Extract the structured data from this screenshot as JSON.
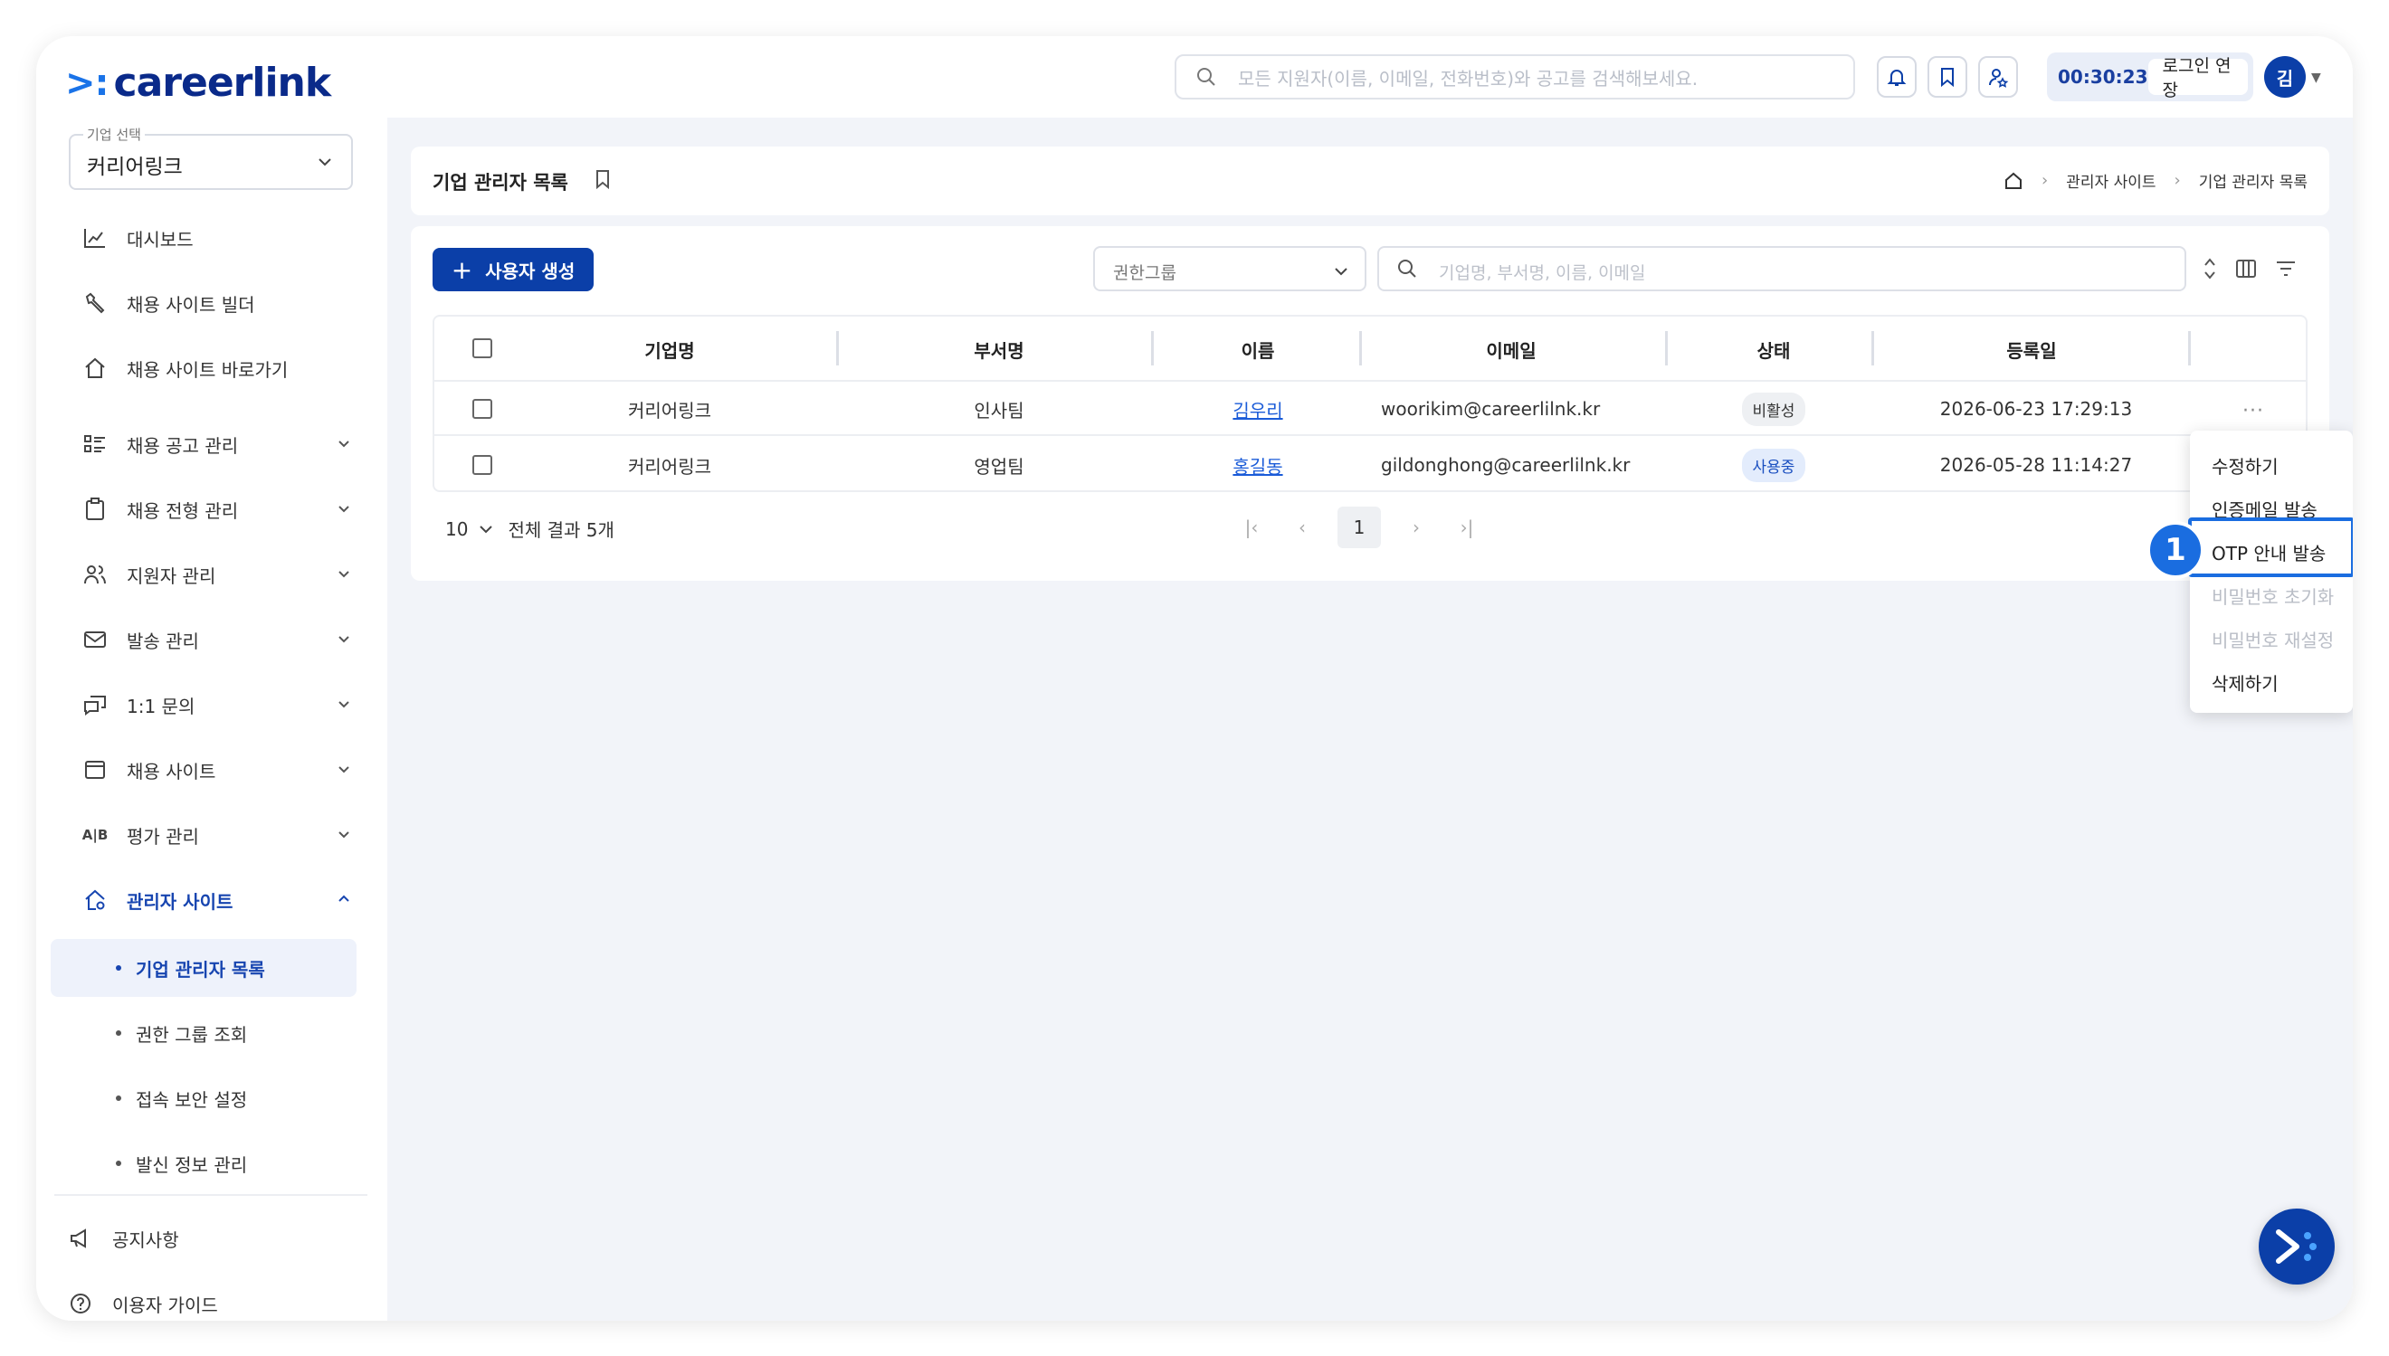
{
  "brand": {
    "logo_text": "careerlink"
  },
  "header": {
    "search_placeholder": "모든 지원자(이름, 이메일, 전화번호)와 공고를 검색해보세요.",
    "session_time": "00:30:23",
    "extend_label": "로그인 연장",
    "avatar_initial": "김"
  },
  "sidebar": {
    "company_label": "기업 선택",
    "company_value": "커리어링크",
    "items": [
      {
        "label": "대시보드"
      },
      {
        "label": "채용 사이트 빌더"
      },
      {
        "label": "채용 사이트 바로가기"
      },
      {
        "label": "채용 공고 관리"
      },
      {
        "label": "채용 전형 관리"
      },
      {
        "label": "지원자 관리"
      },
      {
        "label": "발송 관리"
      },
      {
        "label": "1:1 문의"
      },
      {
        "label": "채용 사이트"
      },
      {
        "label": "평가 관리"
      },
      {
        "label": "관리자 사이트"
      }
    ],
    "sub_items": [
      {
        "label": "기업 관리자 목록"
      },
      {
        "label": "권한 그룹 조회"
      },
      {
        "label": "접속 보안 설정"
      },
      {
        "label": "발신 정보 관리"
      }
    ],
    "footer": [
      {
        "label": "공지사항"
      },
      {
        "label": "이용자 가이드"
      }
    ]
  },
  "page": {
    "title": "기업 관리자 목록",
    "breadcrumb": [
      "관리자 사이트",
      "기업 관리자 목록"
    ]
  },
  "toolbar": {
    "create_label": "사용자 생성",
    "role_select": "권한그룹",
    "search_placeholder": "기업명, 부서명, 이름, 이메일"
  },
  "table": {
    "columns": [
      "기업명",
      "부서명",
      "이름",
      "이메일",
      "상태",
      "등록일"
    ],
    "rows": [
      {
        "company": "커리어링크",
        "dept": "인사팀",
        "name": "김우리",
        "email": "woorikim@careerlilnk.kr",
        "status": "비활성",
        "date": "2026-06-23 17:29:13"
      },
      {
        "company": "커리어링크",
        "dept": "영업팀",
        "name": "홍길동",
        "email": "gildonghong@careerlilnk.kr",
        "status": "사용중",
        "date": "2026-05-28 11:14:27"
      }
    ]
  },
  "pagination": {
    "page_size": "10",
    "total_text": "전체 결과 5개",
    "current_page": "1"
  },
  "context_menu": {
    "items": [
      {
        "label": "수정하기",
        "enabled": true
      },
      {
        "label": "인증메일 발송",
        "enabled": true
      },
      {
        "label": "OTP 안내 발송",
        "enabled": true
      },
      {
        "label": "비밀번호 초기화",
        "enabled": false
      },
      {
        "label": "비밀번호 재설정",
        "enabled": false
      },
      {
        "label": "삭제하기",
        "enabled": true
      }
    ]
  },
  "annotation": {
    "step_number": "1"
  },
  "colors": {
    "primary": "#0b3fa8",
    "link": "#1a5bd8",
    "highlight": "#1a6de0",
    "background": "#f2f4f9"
  }
}
